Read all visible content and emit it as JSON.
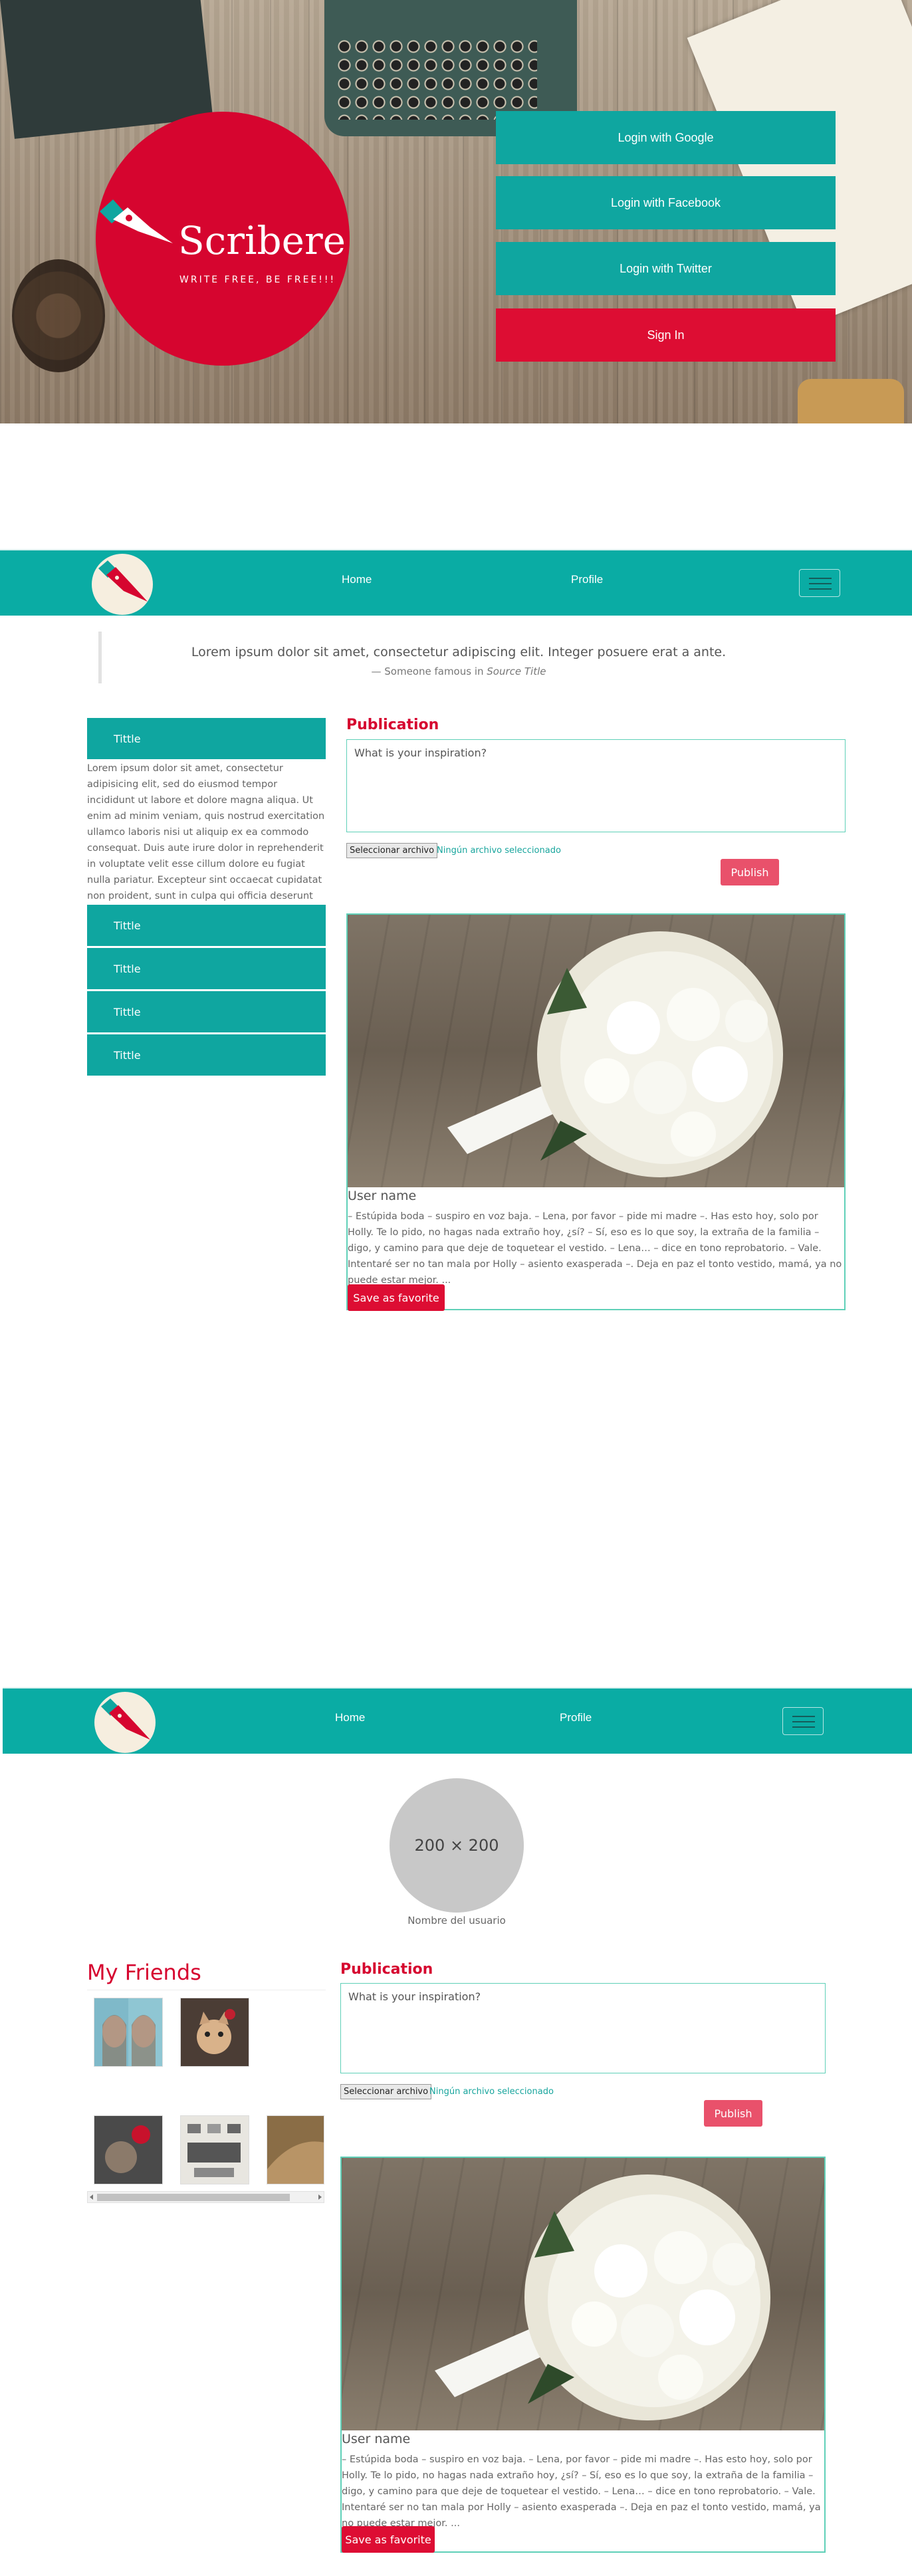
{
  "hero": {
    "logo_text": "Scribere",
    "tagline": "WRITE FREE, BE FREE!!!",
    "buttons": [
      "Login with Google",
      "Login with Facebook",
      "Login with Twitter",
      "Sign In"
    ]
  },
  "nav": {
    "home": "Home",
    "profile": "Profile"
  },
  "quote": {
    "text": "Lorem ipsum dolor sit amet, consectetur adipiscing elit. Integer posuere erat a ante.",
    "cite_prefix": "— Someone famous in ",
    "cite_source": "Source Title"
  },
  "accordion": {
    "items": [
      "Tittle",
      "Tittle",
      "Tittle",
      "Tittle",
      "Tittle"
    ],
    "body": "Lorem ipsum dolor sit amet, consectetur adipisicing elit, sed do eiusmod tempor incididunt ut labore et dolore magna aliqua. Ut enim ad minim veniam, quis nostrud exercitation ullamco laboris nisi ut aliquip ex ea commodo consequat. Duis aute irure dolor in reprehenderit in voluptate velit esse cillum dolore eu fugiat nulla pariatur. Excepteur sint occaecat cupidatat non proident, sunt in culpa qui officia deserunt mollit anim id est laborum"
  },
  "publication": {
    "title": "Publication",
    "placeholder": "What is your inspiration?",
    "file_button": "Seleccionar archivo",
    "file_none": "Ningún archivo seleccionado",
    "publish": "Publish"
  },
  "post": {
    "user": "User name",
    "text": "– Estúpida boda – suspiro en voz baja. – Lena, por favor – pide mi madre –. Has esto hoy, solo por Holly. Te lo pido, no hagas nada extraño hoy, ¿sí? – Sí, eso es lo que soy, la extraña de la familia – digo, y camino para que deje de toquetear el vestido. – Lena… – dice en tono reprobatorio. – Vale. Intentaré ser no tan mala por Holly – asiento exasperada –. Deja en paz el tonto vestido, mamá, ya no puede estar mejor. ...",
    "favorite": "Save as favorite"
  },
  "profile": {
    "avatar_placeholder": "200 × 200",
    "user_name": "Nombre del usuario",
    "friends_title": "My Friends"
  },
  "colors": {
    "teal": "#0fa6a0",
    "red": "#dd0d33",
    "pink": "#e9516b"
  }
}
